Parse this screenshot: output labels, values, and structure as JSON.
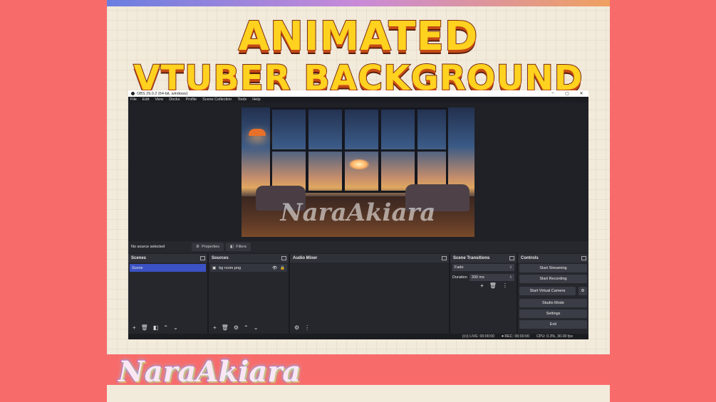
{
  "hero": {
    "line1": "ANIMATED",
    "line2": "VTUBER BACKGROUND"
  },
  "signature": "NaraAkiara",
  "obs": {
    "title": "OBS 29.0.2 (64-bit, windows)",
    "window_buttons": [
      "–",
      "▢",
      "✕"
    ],
    "menu": [
      "File",
      "Edit",
      "View",
      "Docks",
      "Profile",
      "Scene Collection",
      "Tools",
      "Help"
    ],
    "preview_watermark": "NaraAkiara",
    "source_status": "No source selected",
    "properties_label": "Properties",
    "filters_label": "Filters",
    "docks": {
      "scenes": {
        "title": "Scenes",
        "items": [
          "Scene"
        ]
      },
      "sources": {
        "title": "Sources",
        "items": [
          "bg room.png"
        ]
      },
      "mixer": {
        "title": "Audio Mixer"
      },
      "transitions": {
        "title": "Scene Transitions",
        "transition": "Fade",
        "duration_label": "Duration",
        "duration_value": "300 ms"
      },
      "controls": {
        "title": "Controls",
        "buttons": [
          "Start Streaming",
          "Start Recording",
          "Start Virtual Camera",
          "Studio Mode",
          "Settings",
          "Exit"
        ]
      }
    },
    "status": {
      "live": "LIVE: 00:00:00",
      "rec": "REC: 00:00:00",
      "cpu": "CPU: 0.3%, 30.00 fps"
    }
  },
  "colors": {
    "background": "#f86b6b",
    "canvas": "#f2eadb",
    "title_fill": "#ffd21f",
    "scene_selected": "#3b52c4"
  }
}
